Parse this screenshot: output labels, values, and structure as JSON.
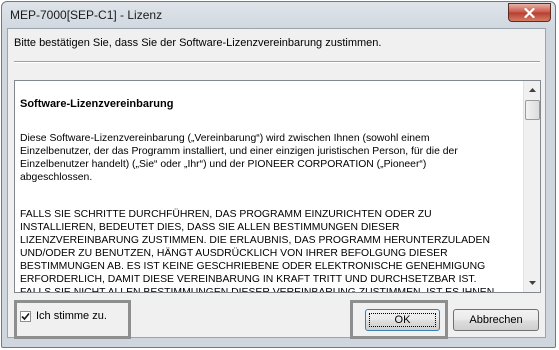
{
  "window": {
    "title": "MEP-7000[SEP-C1] - Lizenz"
  },
  "instruction": "Bitte bestätigen Sie, dass Sie der Software-Lizenzvereinbarung zustimmen.",
  "license": {
    "heading": "Software-Lizenzvereinbarung",
    "paragraph1": "Diese Software-Lizenzvereinbarung („Vereinbarung“) wird zwischen Ihnen (sowohl einem\nEinzelbenutzer, der das Programm installiert, und einer einzigen juristischen Person, für die der\nEinzelbenutzer handelt) („Sie“ oder „Ihr“) und der PIONEER CORPORATION („Pioneer“)\nabgeschlossen.",
    "paragraph2": "FALLS SIE SCHRITTE DURCHFÜHREN, DAS PROGRAMM EINZURICHTEN ODER ZU\nINSTALLIEREN, BEDEUTET DIES, DASS SIE ALLEN BESTIMMUNGEN DIESER\nLIZENZVEREINBARUNG ZUSTIMMEN. DIE ERLAUBNIS, DAS PROGRAMM HERUNTERZULADEN\nUND/ODER ZU BENUTZEN, HÄNGT AUSDRÜCKLICH VON IHRER BEFOLGUNG DIESER\nBESTIMMUNGEN AB. ES IST KEINE GESCHRIEBENE ODER ELEKTRONISCHE GENEHMIGUNG\nERFORDERLICH, DAMIT DIESE VEREINBARUNG IN KRAFT TRITT UND DURCHSETZBAR IST.\nFALLS SIE NICHT ALLEN BESTIMMUNGEN DIESER VEREINBARUNG ZUSTIMMEN, IST ES IHNEN"
  },
  "agree": {
    "label": "Ich stimme zu.",
    "checked": true
  },
  "buttons": {
    "ok": "OK",
    "cancel": "Abbrechen"
  }
}
